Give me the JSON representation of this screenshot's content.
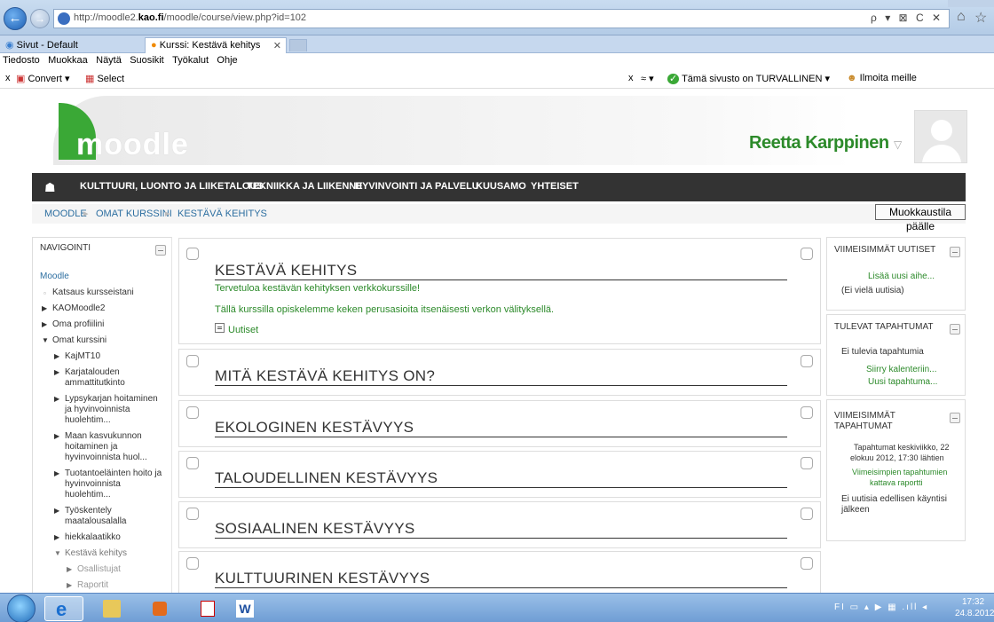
{
  "browser": {
    "url_prefix": "http://moodle2.",
    "url_domain": "kao.fi",
    "url_path": "/moodle/course/view.php?id=102",
    "address_tools": "ρ ▾ ⊠ C ✕",
    "fav_default": "Sivut - Default",
    "active_tab": "Kurssi: Kestävä kehitys",
    "tab_close": "✕",
    "menus": [
      "Tiedosto",
      "Muokkaa",
      "Näytä",
      "Suosikit",
      "Työkalut",
      "Ohje"
    ],
    "toolbar_close": "x",
    "convert_label": "Convert",
    "select_label": "Select",
    "security_text": "Tämä sivusto on TURVALLINEN",
    "report_label": "Ilmoita meille"
  },
  "header": {
    "logo_text": "moodle",
    "user_name": "Reetta Karppinen"
  },
  "nav": {
    "items": [
      "KULTTUURI, LUONTO JA LIIKETALOUS",
      "TEKNIIKKA JA LIIKENNE",
      "HYVINVOINTI JA PALVELU",
      "KUUSAMO",
      "YHTEISET"
    ]
  },
  "breadcrumb": [
    "MOODLE",
    "OMAT KURSSINI",
    "KESTÄVÄ KEHITYS"
  ],
  "edit_mode_button": "Muokkaustila päälle",
  "navigation": {
    "title": "NAVIGOINTI",
    "root": "Moodle",
    "items": [
      "Katsaus kursseistani",
      "KAOMoodle2",
      "Oma profiilini",
      "Omat kurssini",
      "KajMT10",
      "Karjatalouden",
      "ammattitutkinto",
      "Lypsykarjan hoitaminen",
      "ja hyvinvoinnista",
      "huolehtim...",
      "Maan kasvukunnon",
      "hoitaminen ja",
      "hyvinvoinnista huol...",
      "Tuotantoeläinten hoito ja",
      "hyvinvoinnista",
      "huolehtim...",
      "Työskentely",
      "maatalousalalla",
      "hiekkalaatikko",
      "Kestävä kehitys",
      "Osallistujat",
      "Raportit"
    ]
  },
  "sections": {
    "first_title": "KESTÄVÄ KEHITYS",
    "welcome": "Tervetuloa kestävän kehityksen verkkokurssille!",
    "intro": "Tällä kurssilla opiskelemme keken perusasioita itsenäisesti verkon välityksellä.",
    "news_link": "Uutiset",
    "titles": [
      "MITÄ KESTÄVÄ KEHITYS ON?",
      "EKOLOGINEN KESTÄVYYS",
      "TALOUDELLINEN KESTÄVYYS",
      "SOSIAALINEN KESTÄVYYS",
      "KULTTUURINEN KESTÄVYYS"
    ]
  },
  "latest_news": {
    "title": "VIIMEISIMMÄT UUTISET",
    "add_link": "Lisää uusi aihe...",
    "empty": "(Ei vielä uutisia)"
  },
  "upcoming": {
    "title": "TULEVAT TAPAHTUMAT",
    "empty": "Ei tulevia tapahtumia",
    "calendar_link": "Siirry kalenteriin...",
    "new_event_link": "Uusi tapahtuma..."
  },
  "recent": {
    "title_line1": "VIIMEISIMMÄT",
    "title_line2": "TAPAHTUMAT",
    "since_line1": "Tapahtumat keskiviikko, 22",
    "since_line2": "elokuu 2012, 17:30 lähtien",
    "report_line1": "Viimeisimpien tapahtumien",
    "report_line2": "kattava raportti",
    "no_news_line1": "Ei uutisia edellisen käyntisi",
    "no_news_line2": "jälkeen"
  },
  "taskbar": {
    "tray": "FI ▭ ▴ ▶ ▦ .ıll ◂",
    "time": "17:32",
    "date": "24.8.2012"
  }
}
